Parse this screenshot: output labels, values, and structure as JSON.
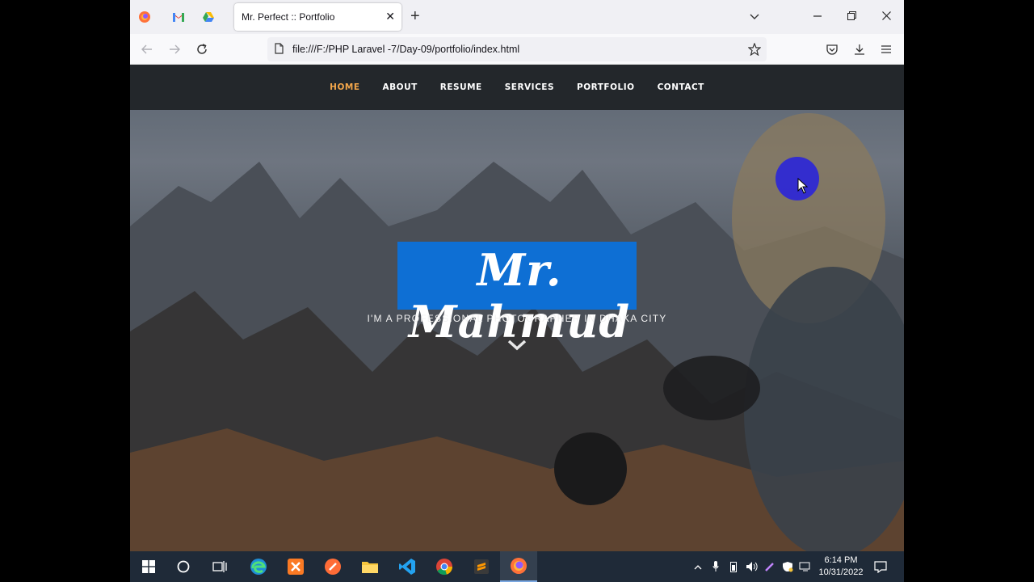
{
  "browser": {
    "tab_title": "Mr. Perfect :: Portfolio",
    "tab_close": "✕",
    "new_tab": "+",
    "url": "file:///F:/PHP Laravel -7/Day-09/portfolio/index.html"
  },
  "site": {
    "nav": [
      {
        "label": "HOME",
        "active": true
      },
      {
        "label": "ABOUT",
        "active": false
      },
      {
        "label": "RESUME",
        "active": false
      },
      {
        "label": "SERVICES",
        "active": false
      },
      {
        "label": "PORTFOLIO",
        "active": false
      },
      {
        "label": "CONTACT",
        "active": false
      }
    ],
    "hero_title": "Mr. Mahmud",
    "hero_subtitle": "I'M A PROFESSIONAL PHOTOGRAPHER IN DHAKA CITY",
    "accent_color": "#f3a64a",
    "highlight_color": "#0e6fd4"
  },
  "taskbar": {
    "time": "6:14 PM",
    "date": "10/31/2022"
  }
}
